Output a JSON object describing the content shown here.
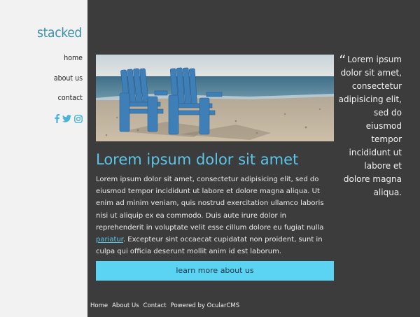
{
  "site": {
    "logo": "stacked"
  },
  "nav": {
    "items": [
      {
        "label": "home"
      },
      {
        "label": "about us"
      },
      {
        "label": "contact"
      }
    ]
  },
  "social": [
    "facebook-icon",
    "twitter-icon",
    "instagram-icon"
  ],
  "main": {
    "heading": "Lorem ipsum dolor sit amet",
    "paragraph_before_link": "Lorem ipsum dolor sit amet, consectetur adipisicing elit, sed do eiusmod tempor incididunt ut labore et dolore magna aliqua. Ut enim ad minim veniam, quis nostrud exercitation ullamco laboris nisi ut aliquip ex ea commodo. Duis aute irure dolor in reprehenderit in voluptate velit esse cillum dolore eu fugiat nulla ",
    "link_text": "pariatur",
    "paragraph_after_link": ". Excepteur sint occaecat cupidatat non proident, sunt in culpa qui officia deserunt mollit anim id est laborum.",
    "cta_label": "learn more about us"
  },
  "quote": {
    "mark": "“",
    "text": "Lorem ipsum dolor sit amet, consectetur adipisicing elit, sed do eiusmod tempor incididunt ut labore et dolore magna aliqua."
  },
  "footer": {
    "links": [
      {
        "label": "Home"
      },
      {
        "label": "About Us"
      },
      {
        "label": "Contact"
      },
      {
        "label": "Powered by OcularCMS"
      }
    ]
  },
  "colors": {
    "accent": "#5bc5e8",
    "button": "#5bd4f4",
    "logo": "#3a8fa8",
    "background": "#3c3c3c",
    "sidebar": "#f2f2f2"
  }
}
